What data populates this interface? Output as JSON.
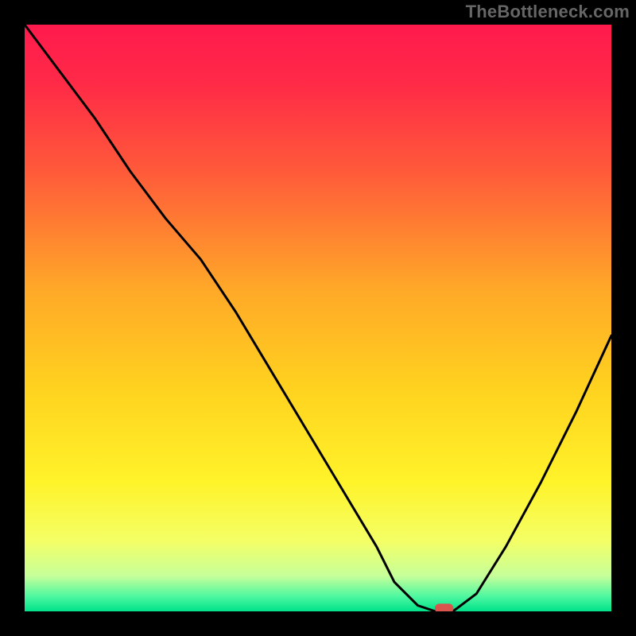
{
  "watermark": "TheBottleneck.com",
  "chart_data": {
    "type": "line",
    "title": "",
    "xlabel": "",
    "ylabel": "",
    "xlim": [
      0,
      100
    ],
    "ylim": [
      0,
      100
    ],
    "note": "No numeric axis ticks visible; values are percentage positions estimated from the image.",
    "series": [
      {
        "name": "bottleneck-curve",
        "x": [
          0,
          6,
          12,
          18,
          24,
          30,
          36,
          42,
          48,
          54,
          60,
          63,
          67,
          70,
          73,
          77,
          82,
          88,
          94,
          100
        ],
        "y": [
          100,
          92,
          84,
          75,
          67,
          60,
          51,
          41,
          31,
          21,
          11,
          5,
          1,
          0,
          0,
          3,
          11,
          22,
          34,
          47
        ]
      }
    ],
    "marker": {
      "x": 71.5,
      "y": 0.5,
      "label": "optimal-point"
    },
    "background_gradient": {
      "stops": [
        {
          "pos": 0.0,
          "color": "#ff1a4d"
        },
        {
          "pos": 0.1,
          "color": "#ff2a47"
        },
        {
          "pos": 0.25,
          "color": "#ff5a3a"
        },
        {
          "pos": 0.45,
          "color": "#ffa828"
        },
        {
          "pos": 0.62,
          "color": "#ffd21f"
        },
        {
          "pos": 0.78,
          "color": "#fff32a"
        },
        {
          "pos": 0.88,
          "color": "#f4ff66"
        },
        {
          "pos": 0.94,
          "color": "#c6ff9a"
        },
        {
          "pos": 0.975,
          "color": "#4cf7a0"
        },
        {
          "pos": 1.0,
          "color": "#00e28a"
        }
      ]
    }
  }
}
